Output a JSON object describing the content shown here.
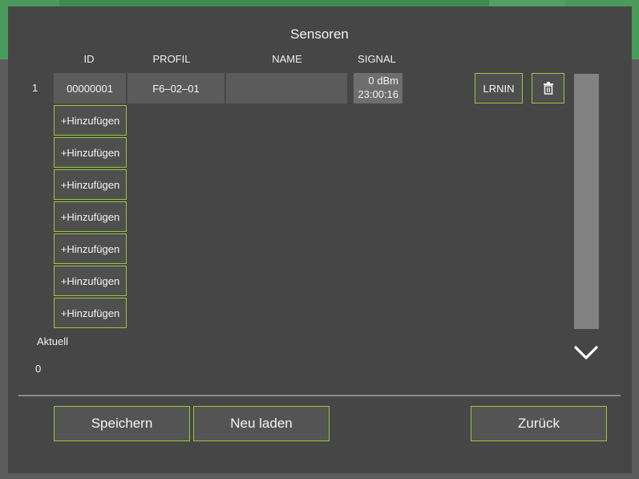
{
  "dialog": {
    "title": "Sensoren",
    "columns": {
      "id": "ID",
      "profil": "PROFIL",
      "name": "NAME",
      "signal": "SIGNAL"
    },
    "rows": [
      {
        "number": "1",
        "id": "00000001",
        "profil": "F6–02–01",
        "name": "",
        "signal_dbm": "0 dBm",
        "signal_time": "23:00:16",
        "learn_label": "LRNIN"
      }
    ],
    "add_buttons": [
      "+Hinzufügen",
      "+Hinzufügen",
      "+Hinzufügen",
      "+Hinzufügen",
      "+Hinzufügen",
      "+Hinzufügen",
      "+Hinzufügen"
    ],
    "current_label": "Aktuell",
    "current_value": "0",
    "icons": {
      "delete": "trash-icon",
      "scroll_down": "chevron-down-icon"
    }
  },
  "footer": {
    "save_label": "Speichern",
    "reload_label": "Neu laden",
    "back_label": "Zurück"
  },
  "colors": {
    "accent": "#9bc73b",
    "modal_bg": "#464646",
    "header_green": "#3d8c4f"
  }
}
